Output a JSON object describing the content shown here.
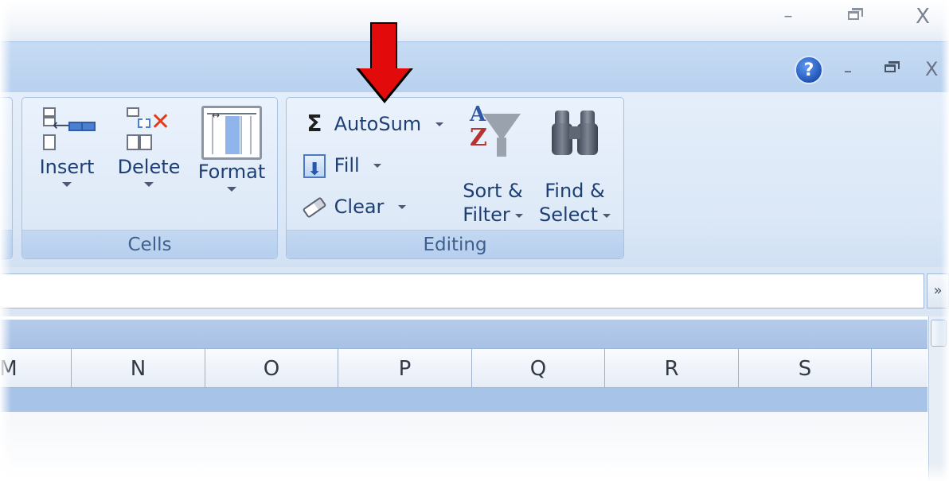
{
  "window_controls": {
    "minimize": "–",
    "close": "X"
  },
  "workbook_controls": {
    "help": "?",
    "minimize": "–",
    "close": "X"
  },
  "ribbon": {
    "cells_group": {
      "label": "Cells",
      "buttons": [
        {
          "label": "Insert",
          "icon": "insert-cells-icon"
        },
        {
          "label": "Delete",
          "icon": "delete-cells-icon"
        },
        {
          "label": "Format",
          "icon": "format-cells-icon"
        }
      ]
    },
    "editing_group": {
      "label": "Editing",
      "autosum": {
        "label": "AutoSum",
        "glyph": "Σ"
      },
      "fill": {
        "label": "Fill"
      },
      "clear": {
        "label": "Clear"
      },
      "sort_filter": {
        "line1": "Sort &",
        "line2": "Filter",
        "glyph_a": "A",
        "glyph_z": "Z"
      },
      "find_select": {
        "line1": "Find &",
        "line2": "Select"
      }
    }
  },
  "annotation": {
    "color": "#e20a0a",
    "points_to": "AutoSum"
  },
  "formula_bar": {
    "value": "",
    "expand_glyph": "»"
  },
  "sheet": {
    "columns": [
      "M",
      "N",
      "O",
      "P",
      "Q",
      "R",
      "S"
    ]
  }
}
